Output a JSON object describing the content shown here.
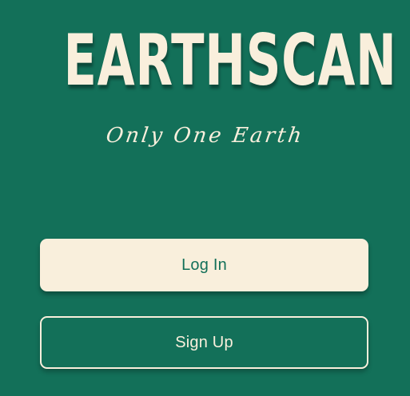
{
  "app": {
    "title": "EARTHSCAN",
    "tagline": "Only One Earth"
  },
  "actions": {
    "login_label": "Log In",
    "signup_label": "Sign Up"
  },
  "colors": {
    "background": "#137059",
    "cream": "#f9efdc"
  }
}
